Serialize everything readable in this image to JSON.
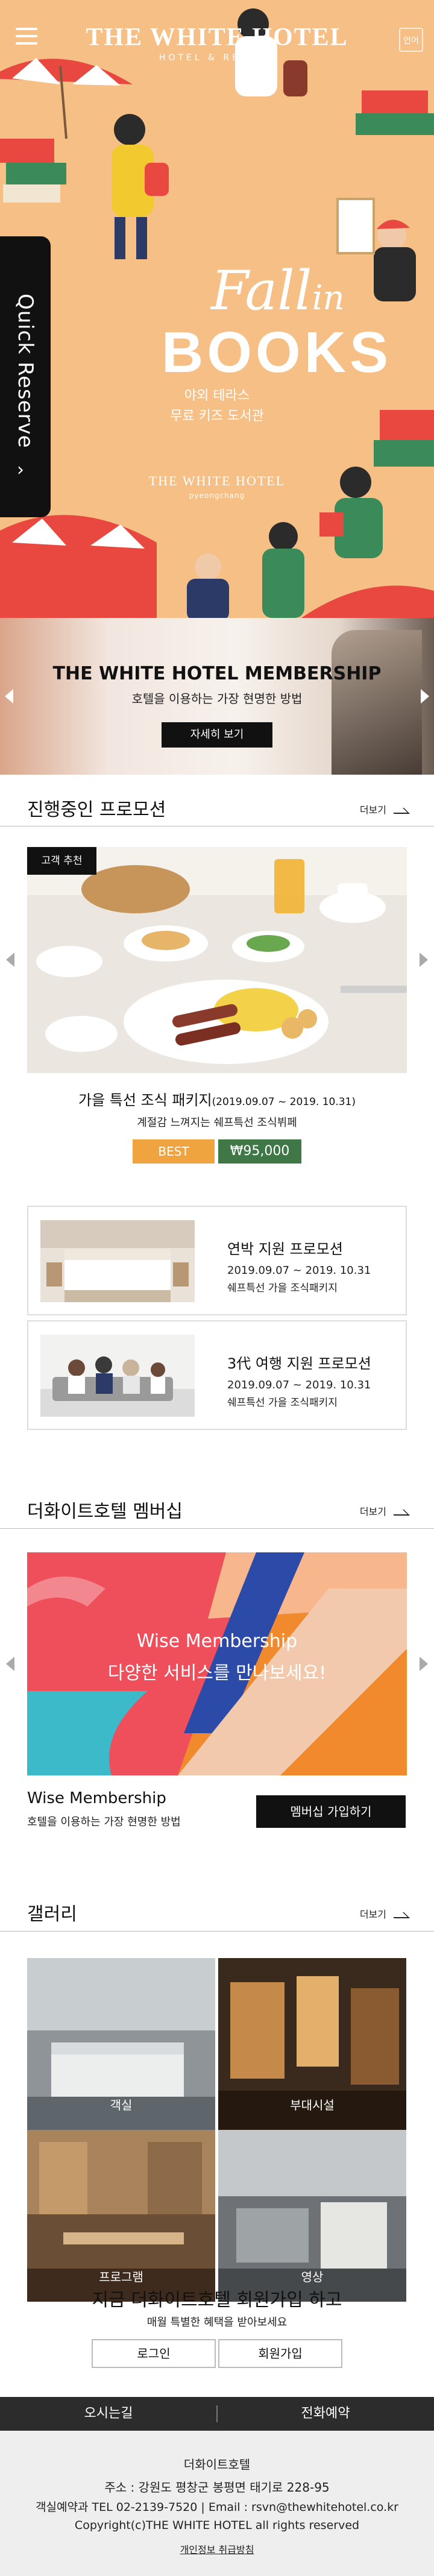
{
  "header": {
    "brand_title": "THE WHITE HOTEL",
    "brand_sub": "HOTEL & RESORT",
    "lang_label": "언어"
  },
  "quick_reserve": {
    "label": "Quick Reserve"
  },
  "hero": {
    "title_script": "Fall",
    "title_script_small": "in",
    "title_main": "BOOKS",
    "subtitle_line1": "야외 테라스",
    "subtitle_line2": "무료 키즈 도서관",
    "logo_title": "THE WHITE HOTEL",
    "logo_sub": "pyeongchang",
    "background_color": "#f6bf86"
  },
  "membership_banner": {
    "title": "THE WHITE HOTEL MEMBERSHIP",
    "subtitle": "호텔을 이용하는 가장 현명한 방법",
    "button": "자세히 보기"
  },
  "promotions": {
    "title": "진행중인 프로모션",
    "more": "더보기",
    "featured": {
      "badge": "고객 추천",
      "name": "가을 특선 조식 패키지",
      "period": "(2019.09.07 ~ 2019. 10.31)",
      "desc": "계절감 느껴지는 쉐프특선 조식뷔페",
      "best": "BEST",
      "price": "₩95,000"
    },
    "cards": [
      {
        "name": "연박 지원 프로모션",
        "date": "2019.09.07 ~ 2019. 10.31",
        "desc": "쉐프특선 가을 조식패키지"
      },
      {
        "name": "3代 여행 지원 프로모션",
        "date": "2019.09.07 ~ 2019. 10.31",
        "desc": "쉐프특선 가을 조식패키지"
      }
    ]
  },
  "membership": {
    "title": "더화이트호텔 멤버십",
    "more": "더보기",
    "banner_line1": "Wise Membership",
    "banner_line2": "다양한 서비스를 만나보세요!",
    "name": "Wise Membership",
    "sub": "호텔을 이용하는 가장 현명한 방법",
    "join": "멤버십 가입하기"
  },
  "gallery": {
    "title": "갤러리",
    "more": "더보기",
    "tiles": [
      "객실",
      "부대시설",
      "프로그램",
      "영상"
    ]
  },
  "signup": {
    "title": "지금 더화이트호텔 회원가입 하고",
    "sub": "매월 특별한 혜택을 받아보세요",
    "login": "로그인",
    "join": "회원가입"
  },
  "bottom_bar": {
    "directions": "오시는길",
    "phone_reserve": "전화예약"
  },
  "footer": {
    "company": "더화이트호텔",
    "address": "주소 : 강원도 평창군 봉평면 태기로 228-95",
    "contact": "객실예약과 TEL 02-2139-7520 | Email : rsvn@thewhitehotel.co.kr",
    "copyright": "Copyright(c)THE WHITE HOTEL all rights reserved",
    "privacy": "개인정보 취급방침"
  }
}
